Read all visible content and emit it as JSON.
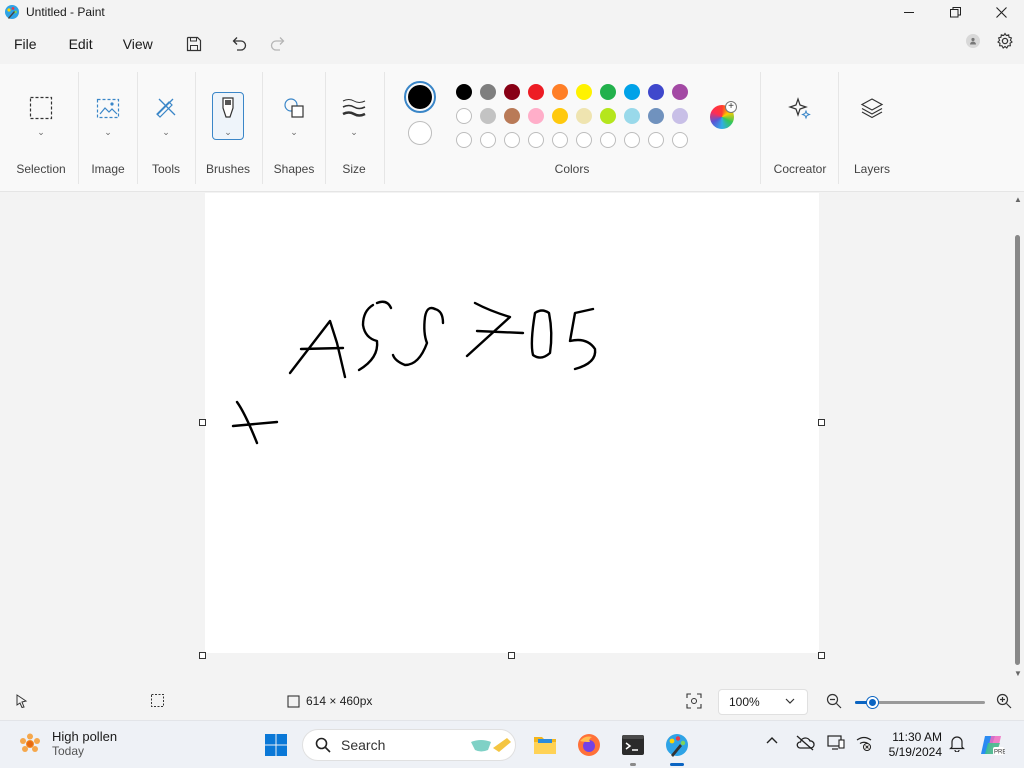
{
  "window": {
    "title": "Untitled - Paint"
  },
  "menu": {
    "file": "File",
    "edit": "Edit",
    "view": "View"
  },
  "ribbon": {
    "groups": {
      "selection": "Selection",
      "image": "Image",
      "tools": "Tools",
      "brushes": "Brushes",
      "shapes": "Shapes",
      "size": "Size",
      "colors": "Colors",
      "cocreator": "Cocreator",
      "layers": "Layers"
    },
    "primary_color": "#000000",
    "secondary_color": "#ffffff",
    "palette_row1": [
      "#000000",
      "#7f7f7f",
      "#880015",
      "#ed1c24",
      "#ff7f27",
      "#fff200",
      "#22b14c",
      "#00a2e8",
      "#3f48cc",
      "#a349a4"
    ],
    "palette_row2": [
      "#ffffff",
      "#c3c3c3",
      "#b97a57",
      "#ffaec9",
      "#ffc90e",
      "#efe4b0",
      "#b5e61d",
      "#99d9ea",
      "#7092be",
      "#c8bfe7"
    ],
    "palette_row3_count": 10
  },
  "canvas": {
    "drawn_text": "ASS705",
    "extra_mark": "+"
  },
  "status": {
    "canvas_size": "614 × 460px",
    "zoom": "100%",
    "zoom_level": 0.13
  },
  "taskbar": {
    "weather_title": "High pollen",
    "weather_sub": "Today",
    "search_placeholder": "Search",
    "time": "11:30 AM",
    "date": "5/19/2024"
  },
  "colors": {
    "accent": "#0a64c2",
    "selected_border": "#3a86c8"
  }
}
